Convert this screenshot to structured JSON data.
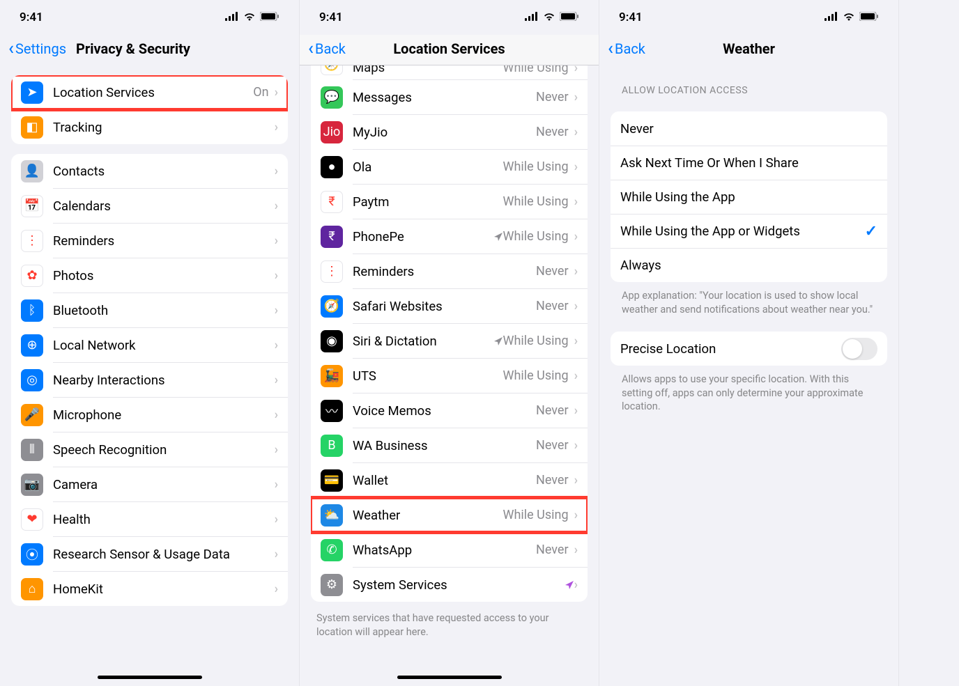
{
  "status": {
    "time": "9:41"
  },
  "screens": [
    {
      "back": "Settings",
      "title": "Privacy & Security",
      "title_inline": true,
      "groups": [
        {
          "rows": [
            {
              "name": "location-services",
              "icon": "location-arrow-icon",
              "bg": "#007aff",
              "glyph": "➤",
              "label": "Location Services",
              "value": "On",
              "highlight": true
            },
            {
              "name": "tracking",
              "icon": "tracking-icon",
              "bg": "#ff9500",
              "glyph": "◧",
              "label": "Tracking"
            }
          ]
        },
        {
          "rows": [
            {
              "name": "contacts",
              "icon": "contacts-icon",
              "bg": "#d1d1d6",
              "glyph": "👤",
              "label": "Contacts"
            },
            {
              "name": "calendars",
              "icon": "calendar-icon",
              "bg": "#ffffff",
              "glyph": "📅",
              "label": "Calendars"
            },
            {
              "name": "reminders",
              "icon": "reminders-icon",
              "bg": "#ffffff",
              "glyph": "⋮",
              "label": "Reminders"
            },
            {
              "name": "photos",
              "icon": "photos-icon",
              "bg": "#ffffff",
              "glyph": "✿",
              "label": "Photos"
            },
            {
              "name": "bluetooth",
              "icon": "bluetooth-icon",
              "bg": "#007aff",
              "glyph": "ᛒ",
              "label": "Bluetooth"
            },
            {
              "name": "local-network",
              "icon": "network-icon",
              "bg": "#007aff",
              "glyph": "⊕",
              "label": "Local Network"
            },
            {
              "name": "nearby-interactions",
              "icon": "nearby-icon",
              "bg": "#007aff",
              "glyph": "◎",
              "label": "Nearby Interactions"
            },
            {
              "name": "microphone",
              "icon": "microphone-icon",
              "bg": "#ff9500",
              "glyph": "🎤",
              "label": "Microphone"
            },
            {
              "name": "speech",
              "icon": "speech-icon",
              "bg": "#8e8e93",
              "glyph": "⦀",
              "label": "Speech Recognition"
            },
            {
              "name": "camera",
              "icon": "camera-icon",
              "bg": "#8e8e93",
              "glyph": "📷",
              "label": "Camera"
            },
            {
              "name": "health",
              "icon": "health-icon",
              "bg": "#ffffff",
              "glyph": "❤",
              "label": "Health"
            },
            {
              "name": "research",
              "icon": "research-icon",
              "bg": "#007aff",
              "glyph": "⦿",
              "label": "Research Sensor & Usage Data"
            },
            {
              "name": "homekit",
              "icon": "homekit-icon",
              "bg": "#ff9500",
              "glyph": "⌂",
              "label": "HomeKit"
            }
          ]
        }
      ]
    },
    {
      "back": "Back",
      "title": "Location Services",
      "title_inline": false,
      "partial_top": {
        "name": "maps",
        "icon": "maps-icon",
        "bg": "#ffffff",
        "glyph": "🧭",
        "label": "Maps",
        "value": "While Using"
      },
      "rows": [
        {
          "name": "messages",
          "icon": "messages-icon",
          "bg": "#34c759",
          "glyph": "💬",
          "label": "Messages",
          "value": "Never"
        },
        {
          "name": "myjio",
          "icon": "myjio-icon",
          "bg": "#d7263d",
          "glyph": "Jio",
          "label": "MyJio",
          "value": "Never"
        },
        {
          "name": "ola",
          "icon": "ola-icon",
          "bg": "#000000",
          "glyph": "●",
          "label": "Ola",
          "value": "While Using"
        },
        {
          "name": "paytm",
          "icon": "paytm-icon",
          "bg": "#ffffff",
          "glyph": "₹",
          "label": "Paytm",
          "value": "While Using"
        },
        {
          "name": "phonepe",
          "icon": "phonepe-icon",
          "bg": "#5f259f",
          "glyph": "₹",
          "label": "PhonePe",
          "value": "While Using",
          "nav_arrow": true
        },
        {
          "name": "reminders2",
          "icon": "reminders-icon",
          "bg": "#ffffff",
          "glyph": "⋮",
          "label": "Reminders",
          "value": "Never"
        },
        {
          "name": "safari",
          "icon": "safari-icon",
          "bg": "#007aff",
          "glyph": "🧭",
          "label": "Safari Websites",
          "value": "Never"
        },
        {
          "name": "siri",
          "icon": "siri-icon",
          "bg": "#000000",
          "glyph": "◉",
          "label": "Siri & Dictation",
          "value": "While Using",
          "nav_arrow": true
        },
        {
          "name": "uts",
          "icon": "uts-icon",
          "bg": "#ff9500",
          "glyph": "🚂",
          "label": "UTS",
          "value": "While Using"
        },
        {
          "name": "voice-memos",
          "icon": "voicememos-icon",
          "bg": "#000000",
          "glyph": "〰",
          "label": "Voice Memos",
          "value": "Never"
        },
        {
          "name": "wa-business",
          "icon": "wabusiness-icon",
          "bg": "#25d366",
          "glyph": "B",
          "label": "WA Business",
          "value": "Never"
        },
        {
          "name": "wallet",
          "icon": "wallet-icon",
          "bg": "#000000",
          "glyph": "💳",
          "label": "Wallet",
          "value": "Never"
        },
        {
          "name": "weather",
          "icon": "weather-icon",
          "bg": "#1e88e5",
          "glyph": "⛅",
          "label": "Weather",
          "value": "While Using",
          "highlight": true
        },
        {
          "name": "whatsapp",
          "icon": "whatsapp-icon",
          "bg": "#25d366",
          "glyph": "✆",
          "label": "WhatsApp",
          "value": "Never"
        },
        {
          "name": "system-services",
          "icon": "gear-icon",
          "bg": "#8e8e93",
          "glyph": "⚙",
          "label": "System Services",
          "nav_arrow_purple": true
        }
      ],
      "footer": "System services that have requested access to your location will appear here."
    },
    {
      "back": "Back",
      "title": "Weather",
      "title_inline": false,
      "section_header": "ALLOW LOCATION ACCESS",
      "options": [
        {
          "name": "opt-never",
          "label": "Never"
        },
        {
          "name": "opt-ask",
          "label": "Ask Next Time Or When I Share"
        },
        {
          "name": "opt-while-using",
          "label": "While Using the App"
        },
        {
          "name": "opt-while-widgets",
          "label": "While Using the App or Widgets",
          "checked": true
        },
        {
          "name": "opt-always",
          "label": "Always"
        }
      ],
      "explanation": "App explanation: \"Your location is used to show local weather and send notifications about weather near you.\"",
      "precise": {
        "label": "Precise Location",
        "on": false
      },
      "precise_footer": "Allows apps to use your specific location. With this setting off, apps can only determine your approximate location."
    }
  ]
}
